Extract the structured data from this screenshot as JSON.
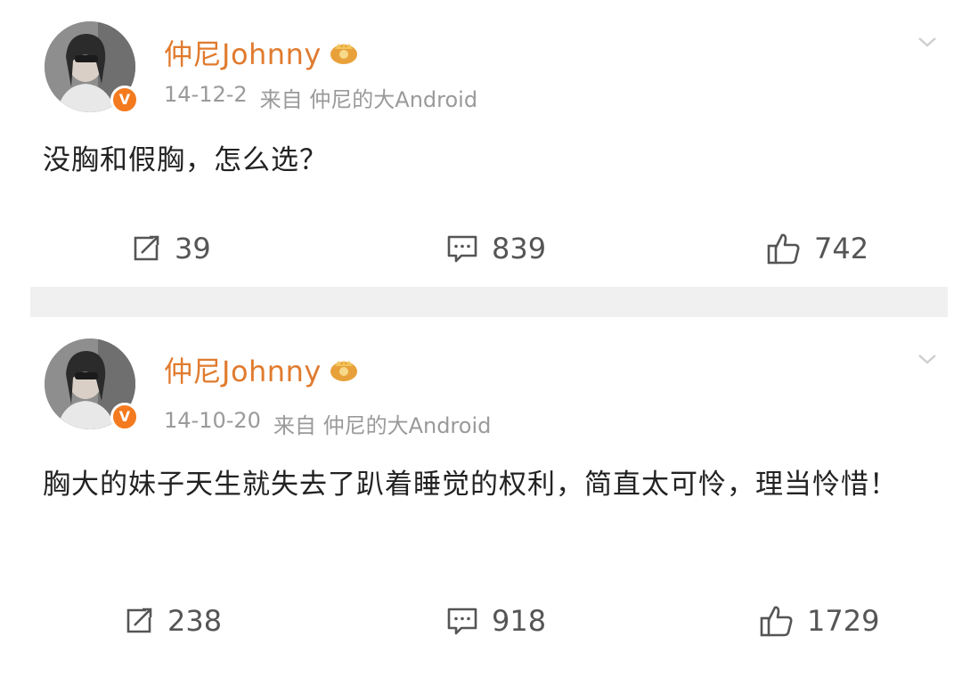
{
  "posts": [
    {
      "user_name": "仲尼Johnny",
      "date": "14-12-2",
      "source": "来自 仲尼的大Android",
      "text": "没胸和假胸，怎么选？",
      "reposts": "39",
      "comments": "839",
      "likes": "742",
      "icons": {
        "verified": "v-badge-icon",
        "vip": "vip-crown-icon",
        "more": "chevron-down-icon",
        "repost": "repost-icon",
        "comment": "comment-icon",
        "like": "thumbs-up-icon"
      }
    },
    {
      "user_name": "仲尼Johnny",
      "date": "14-10-20",
      "source": "来自 仲尼的大Android",
      "text": "胸大的妹子天生就失去了趴着睡觉的权利，简直太可怜，理当怜惜！",
      "reposts": "238",
      "comments": "918",
      "likes": "1729",
      "icons": {
        "verified": "v-badge-icon",
        "vip": "vip-crown-icon",
        "more": "chevron-down-icon",
        "repost": "repost-icon",
        "comment": "comment-icon",
        "like": "thumbs-up-icon"
      }
    }
  ],
  "badge_letter": "V",
  "colors": {
    "name": "#e07b2e",
    "badge": "#f47a1f",
    "meta": "#9a9a9a",
    "text": "#222222",
    "separator": "#f0f0f0"
  }
}
